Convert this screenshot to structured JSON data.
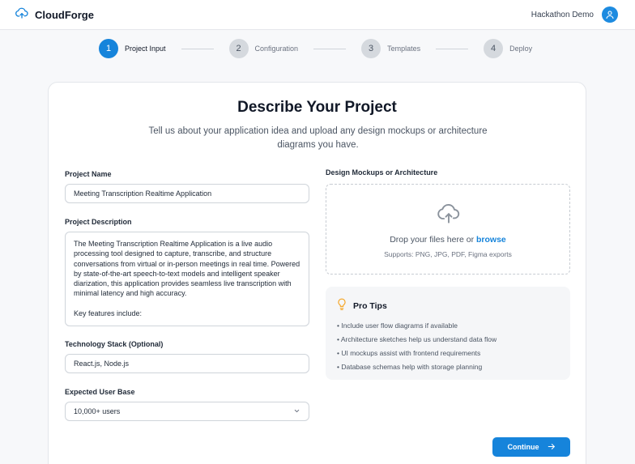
{
  "app": {
    "brand": "CloudForge",
    "user_name": "Hackathon Demo",
    "brand_color": "#1684db"
  },
  "stepper": {
    "steps": [
      {
        "number": "1",
        "label": "Project Input",
        "active": true
      },
      {
        "number": "2",
        "label": "Configuration",
        "active": false
      },
      {
        "number": "3",
        "label": "Templates",
        "active": false
      },
      {
        "number": "4",
        "label": "Deploy",
        "active": false
      }
    ]
  },
  "form": {
    "title": "Describe Your Project",
    "subtitle": "Tell us about your application idea and upload any design mockups or architecture diagrams you have.",
    "project_name": {
      "label": "Project Name",
      "value": "Meeting Transcription Realtime Application"
    },
    "project_description": {
      "label": "Project Description",
      "value": "The Meeting Transcription Realtime Application is a live audio\nprocessing tool designed to capture, transcribe, and structure\nconversations from virtual or in-person meetings in real time. Powered\nby state-of-the-art speech-to-text models and intelligent speaker\ndiarization, this application provides seamless live transcription with\nminimal latency and high accuracy.\n\nKey features include:"
    },
    "tech_stack": {
      "label": "Technology Stack (Optional)",
      "value": "React.js,  Node.js"
    },
    "user_base": {
      "label": "Expected User Base",
      "selected": "10,000+ users"
    },
    "design": {
      "label": "Design Mockups or Architecture",
      "drop_text": "Drop your files here or",
      "browse": "browse",
      "hint": "Supports: PNG, JPG, PDF, Figma exports"
    },
    "tips": {
      "title": "Pro Tips",
      "items": [
        "• Include user flow diagrams if available",
        "• Architecture sketches help us understand data flow",
        "• UI mockups assist with frontend requirements",
        "• Database schemas help with storage planning"
      ]
    },
    "continue_label": "Continue"
  }
}
